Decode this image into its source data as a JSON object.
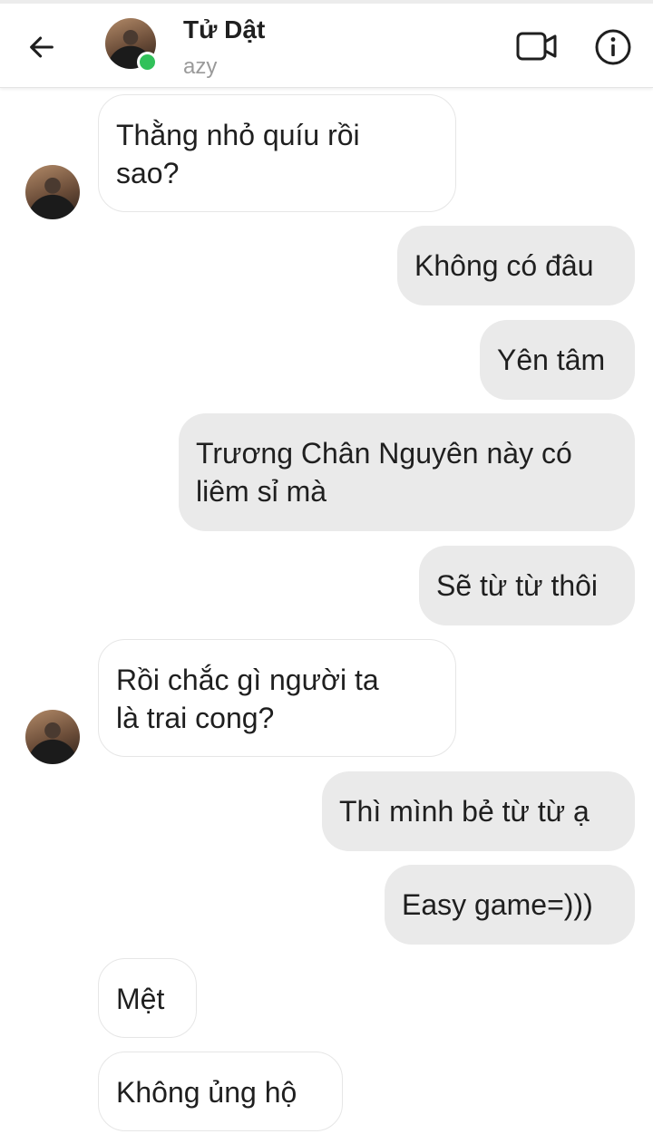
{
  "header": {
    "name": "Tử Dật",
    "subtitle": "azy",
    "icons": {
      "back": "arrow-left-icon",
      "video": "video-camera-icon",
      "info": "info-circle-icon"
    },
    "online_color": "#31c15a"
  },
  "messages": [
    {
      "side": "incoming",
      "text": "Thằng nhỏ quíu rồi\nsao?"
    },
    {
      "side": "outgoing",
      "text": "Không có đâu"
    },
    {
      "side": "outgoing",
      "text": "Yên tâm"
    },
    {
      "side": "outgoing",
      "text": "Trương Chân Nguyên này có\nliêm sỉ mà"
    },
    {
      "side": "outgoing",
      "text": "Sẽ từ từ thôi"
    },
    {
      "side": "incoming",
      "text": "Rồi chắc gì người ta\nlà trai cong?"
    },
    {
      "side": "outgoing",
      "text": "Thì mình bẻ từ từ ạ"
    },
    {
      "side": "outgoing",
      "text": "Easy game=)))"
    },
    {
      "side": "incoming",
      "text": "Mệt"
    },
    {
      "side": "incoming",
      "text": "Không ủng hộ"
    }
  ]
}
